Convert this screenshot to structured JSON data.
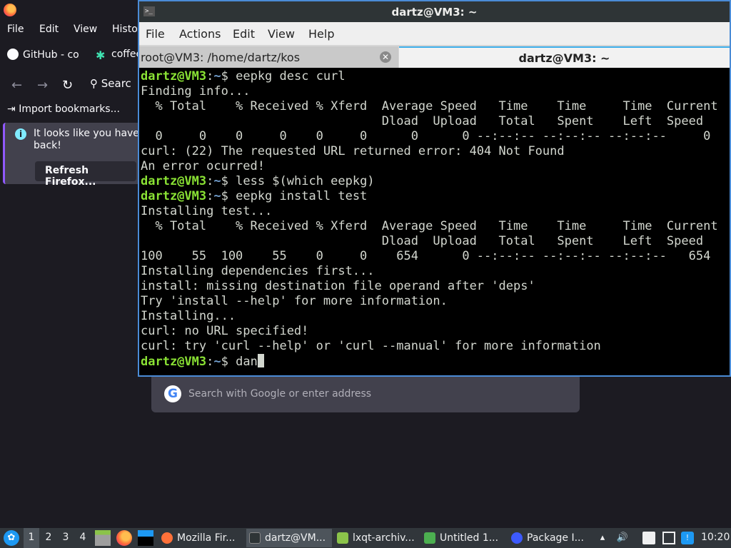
{
  "firefox": {
    "menu": [
      "File",
      "Edit",
      "View",
      "Histo"
    ],
    "tabs": [
      {
        "label": "GitHub - co",
        "icon": "github-icon"
      },
      {
        "label": "coffee",
        "icon": "coffee-icon"
      }
    ],
    "search_label": "Searc",
    "bookmarks_label": "Import bookmarks...",
    "notice": {
      "text": "It looks like you haven back!",
      "button": "Refresh Firefox..."
    },
    "urlbar_placeholder": "Search with Google or enter address"
  },
  "terminal": {
    "title": "dartz@VM3: ~",
    "menu": [
      "File",
      "Actions",
      "Edit",
      "View",
      "Help"
    ],
    "tabs": [
      {
        "label": "root@VM3: /home/dartz/kos",
        "active": false
      },
      {
        "label": "dartz@VM3: ~",
        "active": true
      }
    ],
    "prompt_user": "dartz@VM3",
    "prompt_path": "~",
    "lines": [
      {
        "cmd": " eepkg desc curl"
      },
      {
        "text": "Finding info..."
      },
      {
        "text": "  % Total    % Received % Xferd  Average Speed   Time    Time     Time  Current"
      },
      {
        "text": "                                 Dload  Upload   Total   Spent    Left  Speed"
      },
      {
        "text": "  0     0    0     0    0     0      0      0 --:--:-- --:--:-- --:--:--     0"
      },
      {
        "text": "curl: (22) The requested URL returned error: 404 Not Found"
      },
      {
        "text": "An error ocurred!"
      },
      {
        "cmd": " less $(which eepkg)"
      },
      {
        "cmd": " eepkg install test"
      },
      {
        "text": "Installing test..."
      },
      {
        "text": "  % Total    % Received % Xferd  Average Speed   Time    Time     Time  Current"
      },
      {
        "text": "                                 Dload  Upload   Total   Spent    Left  Speed"
      },
      {
        "text": "100    55  100    55    0     0    654      0 --:--:-- --:--:-- --:--:--   654"
      },
      {
        "text": "Installing dependencies first..."
      },
      {
        "text": "install: missing destination file operand after 'deps'"
      },
      {
        "text": "Try 'install --help' for more information."
      },
      {
        "text": "Installing..."
      },
      {
        "text": "curl: no URL specified!"
      },
      {
        "text": "curl: try 'curl --help' or 'curl --manual' for more information"
      },
      {
        "cmd": " dan",
        "cursor": true
      }
    ]
  },
  "taskbar": {
    "desktops": [
      "1",
      "2",
      "3",
      "4"
    ],
    "tasks": [
      {
        "label": "Mozilla Fir...",
        "icon": "firefox-icon",
        "color": "#ff7139"
      },
      {
        "label": "dartz@VM...",
        "icon": "terminal-icon",
        "color": "#2e3436"
      },
      {
        "label": "lxqt-archiv...",
        "icon": "archive-icon",
        "color": "#8bc34a"
      },
      {
        "label": "Untitled 1...",
        "icon": "document-icon",
        "color": "#4caf50"
      },
      {
        "label": "Package I...",
        "icon": "package-icon",
        "color": "#3d5afe"
      }
    ],
    "clock": "10:20"
  },
  "colors": {
    "prompt_user": "#8ae234",
    "prompt_path": "#729fcf",
    "terminal_fg": "#d3d7cf",
    "accent": "#4a8bd6"
  }
}
